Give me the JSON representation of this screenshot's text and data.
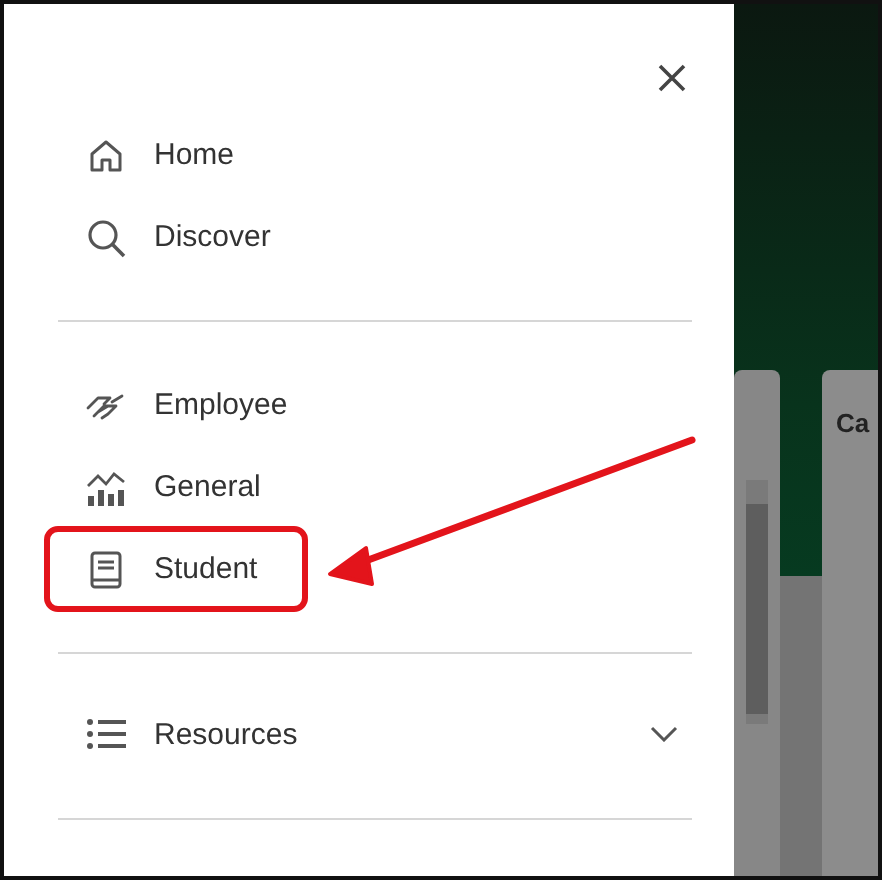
{
  "menu": {
    "sections": [
      {
        "items": [
          {
            "label": "Home",
            "kind": "home",
            "highlighted": false
          },
          {
            "label": "Discover",
            "kind": "search",
            "highlighted": false
          }
        ]
      },
      {
        "items": [
          {
            "label": "Employee",
            "kind": "handshake",
            "highlighted": false
          },
          {
            "label": "General",
            "kind": "chart",
            "highlighted": false
          },
          {
            "label": "Student",
            "kind": "book",
            "highlighted": true
          }
        ]
      }
    ],
    "resources": {
      "label": "Resources",
      "expanded": false
    }
  },
  "background": {
    "card_title": "Ca"
  }
}
